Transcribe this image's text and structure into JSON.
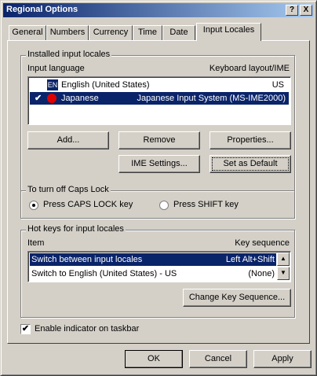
{
  "window": {
    "title": "Regional Options",
    "help_btn": "?",
    "close_btn": "X"
  },
  "tabs": [
    {
      "label": "General"
    },
    {
      "label": "Numbers"
    },
    {
      "label": "Currency"
    },
    {
      "label": "Time"
    },
    {
      "label": "Date"
    },
    {
      "label": "Input Locales",
      "active": true
    }
  ],
  "installed": {
    "legend": "Installed input locales",
    "col_language": "Input language",
    "col_layout": "Keyboard layout/IME",
    "rows": [
      {
        "badge": "EN",
        "language": "English (United States)",
        "layout": "US",
        "checked": false,
        "selected": false
      },
      {
        "badge": "",
        "language": "Japanese",
        "layout": "Japanese Input System (MS-IME2000)",
        "checked": true,
        "selected": true
      }
    ],
    "buttons": {
      "add": "Add...",
      "remove": "Remove",
      "properties": "Properties...",
      "ime_settings": "IME Settings...",
      "set_default": "Set as Default"
    }
  },
  "caps": {
    "legend": "To turn off Caps Lock",
    "option1": "Press CAPS LOCK key",
    "option2": "Press SHIFT key",
    "selected": 1
  },
  "hotkeys": {
    "legend": "Hot keys for input locales",
    "col_item": "Item",
    "col_key": "Key sequence",
    "rows": [
      {
        "item": "Switch between input locales",
        "key": "Left Alt+Shift",
        "selected": true
      },
      {
        "item": "Switch to English (United States) - US",
        "key": "(None)",
        "selected": false
      }
    ],
    "change_btn": "Change Key Sequence..."
  },
  "indicator": {
    "label": "Enable indicator on taskbar",
    "checked": true,
    "check_mark": "✔"
  },
  "footer": {
    "ok": "OK",
    "cancel": "Cancel",
    "apply": "Apply"
  },
  "colors": {
    "selection": "#0a246a",
    "face": "#d4d0c8"
  }
}
